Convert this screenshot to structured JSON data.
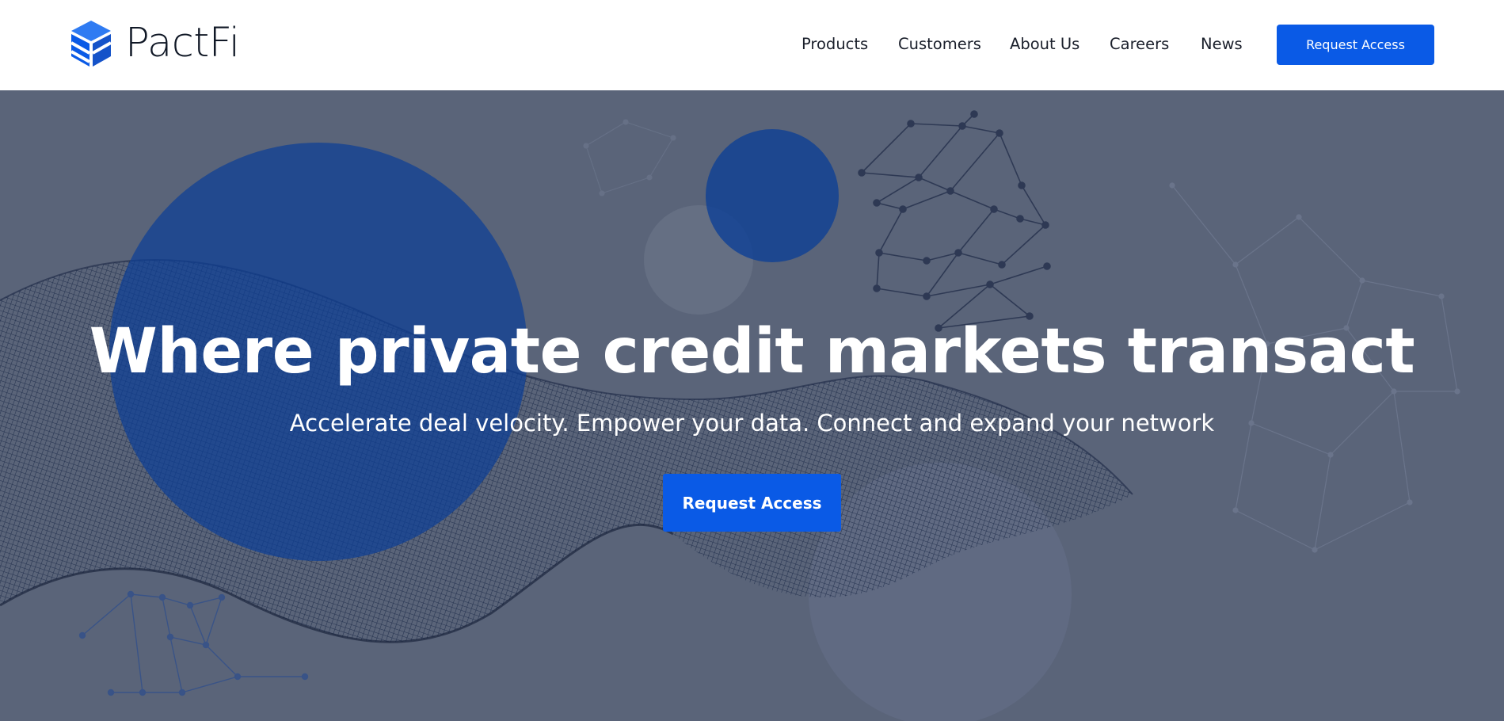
{
  "brand": {
    "name": "PactFi",
    "logo_icon": "pactfi-cube-logo"
  },
  "nav": {
    "items": [
      {
        "label": "Products"
      },
      {
        "label": "Customers"
      },
      {
        "label": "About Us"
      },
      {
        "label": "Careers"
      },
      {
        "label": "News"
      }
    ],
    "cta_label": "Request Access"
  },
  "hero": {
    "headline": "Where private credit markets transact",
    "subheadline": "Accelerate deal velocity. Empower your data. Connect and expand your network",
    "cta_label": "Request Access"
  },
  "colors": {
    "accent": "#0a5ae6",
    "hero_background": "#5a6479",
    "header_background": "#ffffff",
    "text_dark": "#101826"
  }
}
